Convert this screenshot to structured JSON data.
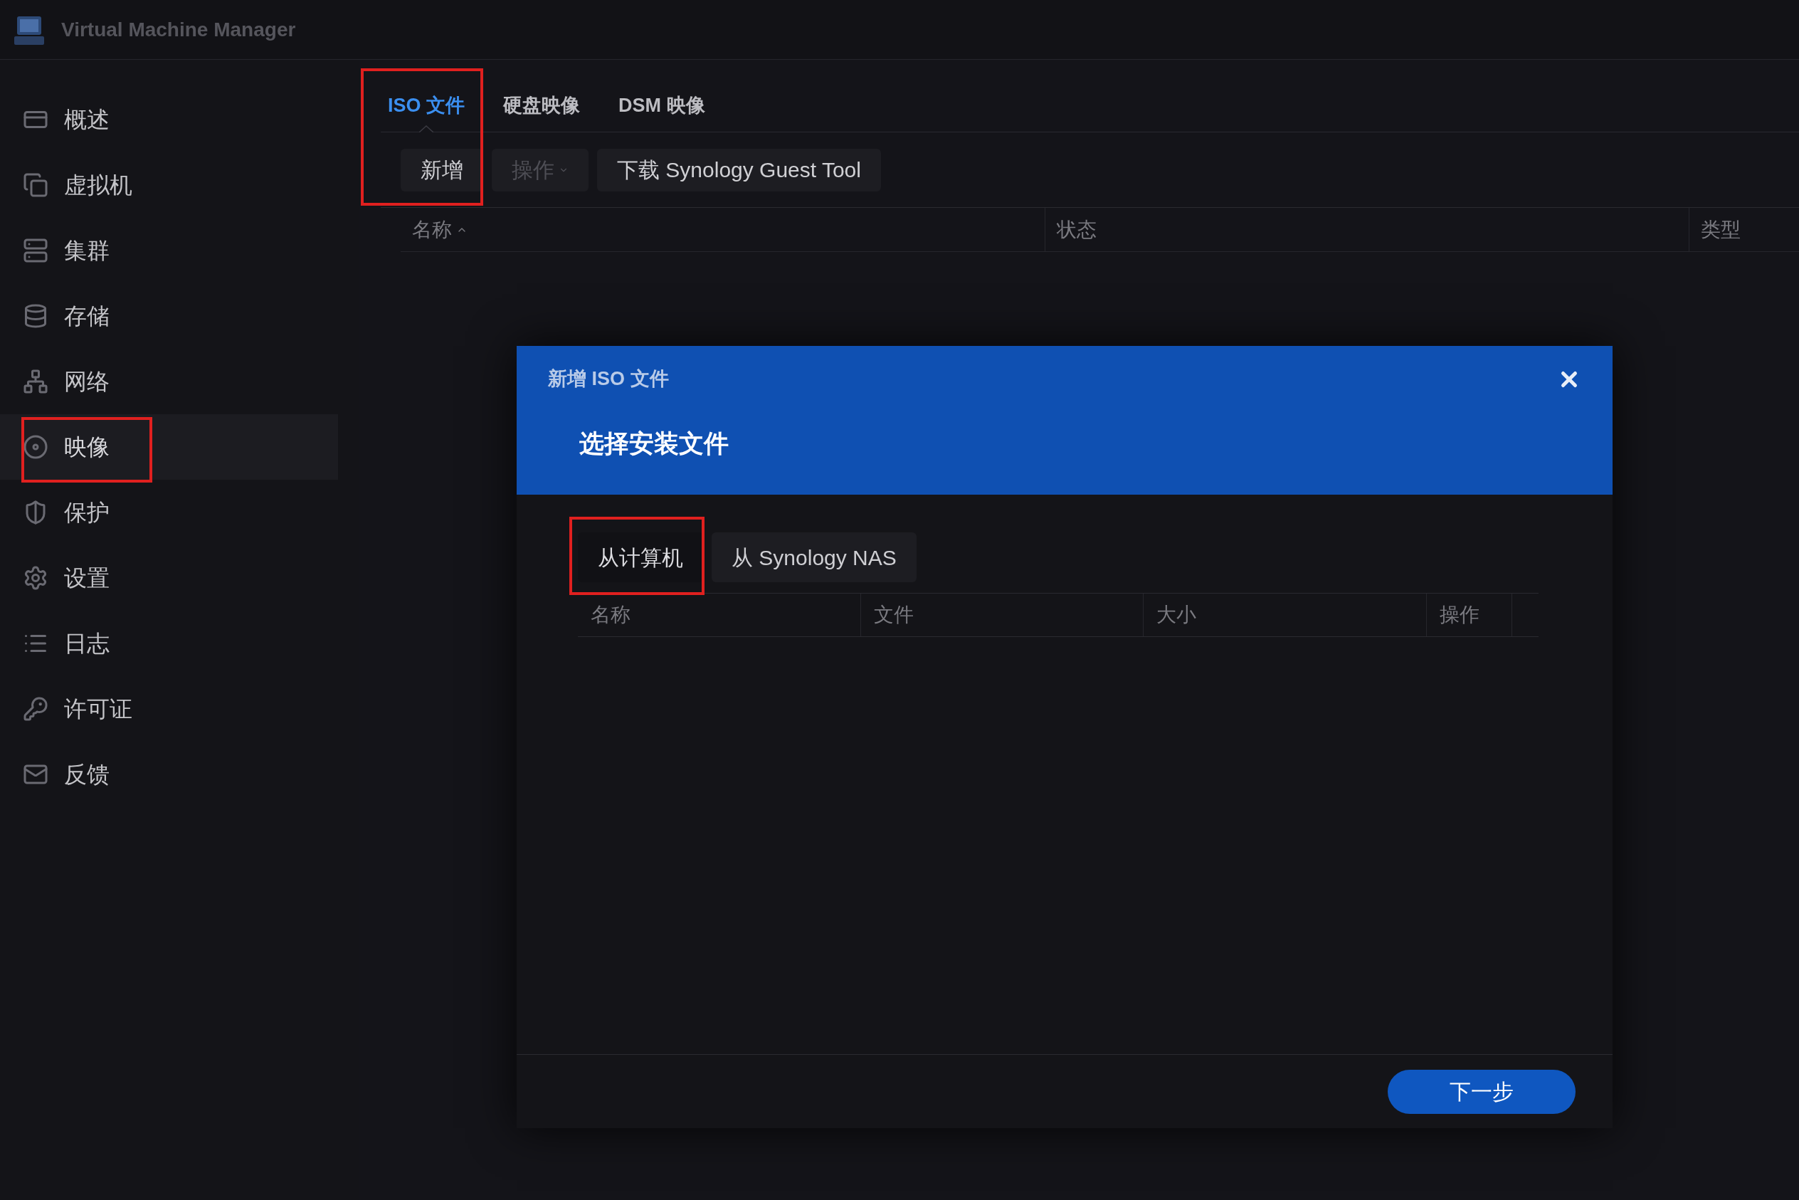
{
  "app": {
    "title": "Virtual Machine Manager"
  },
  "sidebar": {
    "items": [
      {
        "label": "概述",
        "selected": false,
        "highlighted": false
      },
      {
        "label": "虚拟机",
        "selected": false,
        "highlighted": false
      },
      {
        "label": "集群",
        "selected": false,
        "highlighted": false
      },
      {
        "label": "存储",
        "selected": false,
        "highlighted": false
      },
      {
        "label": "网络",
        "selected": false,
        "highlighted": false
      },
      {
        "label": "映像",
        "selected": true,
        "highlighted": true
      },
      {
        "label": "保护",
        "selected": false,
        "highlighted": false
      },
      {
        "label": "设置",
        "selected": false,
        "highlighted": false
      },
      {
        "label": "日志",
        "selected": false,
        "highlighted": false
      },
      {
        "label": "许可证",
        "selected": false,
        "highlighted": false
      },
      {
        "label": "反馈",
        "selected": false,
        "highlighted": false
      }
    ]
  },
  "main": {
    "highlighted": true,
    "tabs": [
      {
        "label": "ISO 文件",
        "selected": true
      },
      {
        "label": "硬盘映像",
        "selected": false
      },
      {
        "label": "DSM 映像",
        "selected": false
      }
    ],
    "toolbar": [
      {
        "label": "新增",
        "disabled": false,
        "dropdown": false
      },
      {
        "label": "操作",
        "disabled": true,
        "dropdown": true
      },
      {
        "label": "下载 Synology Guest Tool",
        "disabled": false,
        "dropdown": false
      }
    ],
    "table": {
      "columns": [
        {
          "label": "名称",
          "sorted": true
        },
        {
          "label": "状态",
          "sorted": false
        },
        {
          "label": "类型",
          "sorted": false
        }
      ]
    }
  },
  "dialog": {
    "title": "新增 ISO 文件",
    "heading": "选择安装文件",
    "source_tabs": [
      {
        "label": "从计算机",
        "selected": true,
        "highlighted": true
      },
      {
        "label": "从 Synology NAS",
        "selected": false,
        "highlighted": false
      }
    ],
    "table": {
      "columns": [
        "名称",
        "文件",
        "大小",
        "操作"
      ]
    },
    "primary_button": "下一步"
  }
}
